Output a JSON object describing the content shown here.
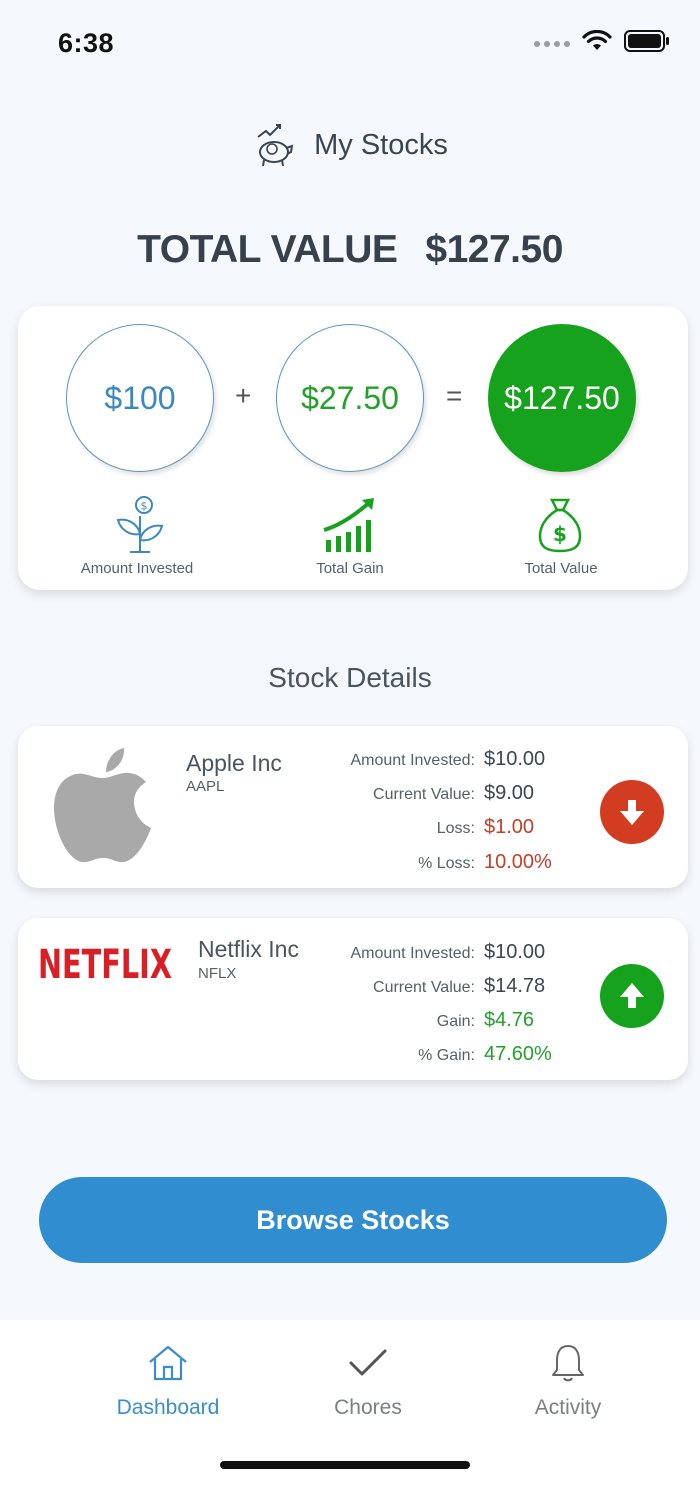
{
  "status_bar": {
    "time": "6:38"
  },
  "header": {
    "title": "My Stocks"
  },
  "total": {
    "label": "TOTAL VALUE",
    "value": "$127.50"
  },
  "summary": {
    "invested": {
      "value": "$100",
      "label": "Amount Invested"
    },
    "gain": {
      "value": "$27.50",
      "label": "Total Gain"
    },
    "total": {
      "value": "$127.50",
      "label": "Total Value"
    },
    "plus": "+",
    "equals": "="
  },
  "stock_details": {
    "title": "Stock Details",
    "stocks": [
      {
        "name": "Apple Inc",
        "ticker": "AAPL",
        "logo": "apple-logo",
        "rows": [
          {
            "label": "Amount Invested:",
            "value": "$10.00"
          },
          {
            "label": "Current Value:",
            "value": "$9.00"
          },
          {
            "label": "Loss:",
            "value": "$1.00"
          },
          {
            "label": "% Loss:",
            "value": "10.00%"
          }
        ],
        "trend": "down",
        "trend_color": "#d23d22"
      },
      {
        "name": "Netflix Inc",
        "ticker": "NFLX",
        "logo_text": "NETFLIX",
        "rows": [
          {
            "label": "Amount Invested:",
            "value": "$10.00"
          },
          {
            "label": "Current Value:",
            "value": "$14.78"
          },
          {
            "label": "Gain:",
            "value": "$4.76"
          },
          {
            "label": "% Gain:",
            "value": "47.60%"
          }
        ],
        "trend": "up",
        "trend_color": "#17a21d"
      }
    ]
  },
  "browse_button": {
    "label": "Browse Stocks"
  },
  "tabs": [
    {
      "label": "Dashboard",
      "icon": "home-icon",
      "active": true
    },
    {
      "label": "Chores",
      "icon": "checkmark-icon",
      "active": false
    },
    {
      "label": "Activity",
      "icon": "bell-icon",
      "active": false
    }
  ],
  "colors": {
    "accent": "#2f8dd0",
    "gain": "#17a21d",
    "loss": "#d23d22"
  }
}
